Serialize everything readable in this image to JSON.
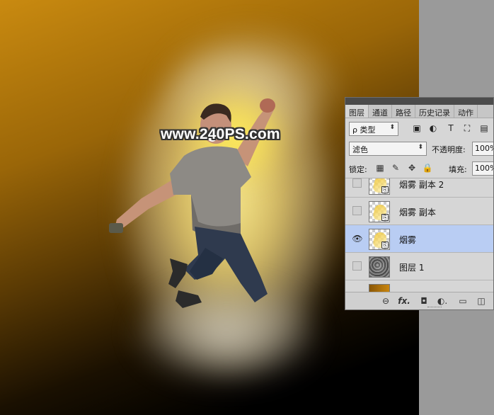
{
  "watermark": "www.240PS.com",
  "panel": {
    "tabs": [
      {
        "label": "图层",
        "active": true
      },
      {
        "label": "通道",
        "active": false
      },
      {
        "label": "路径",
        "active": false
      },
      {
        "label": "历史记录",
        "active": false
      },
      {
        "label": "动作",
        "active": false
      }
    ],
    "filter": {
      "label": "ρ 类型",
      "caret": "⬍"
    },
    "filter_icons": [
      "image-icon",
      "adjustment-icon",
      "type-icon",
      "transform-icon",
      "smart-object-icon"
    ],
    "filter_glyphs": [
      "▣",
      "◐",
      "T",
      "⛶",
      "▤"
    ],
    "blend_mode": "滤色",
    "blend_caret": "⬍",
    "opacity_label": "不透明度:",
    "opacity_value": "100%",
    "lock_label": "锁定:",
    "lock_glyphs": [
      "▦",
      "✎",
      "✥",
      "🔒"
    ],
    "fill_label": "填充:",
    "fill_value": "100%",
    "layers": [
      {
        "name": "烟雾 副本 2",
        "visible": false,
        "selected": false,
        "thumb": "smart"
      },
      {
        "name": "烟雾 副本",
        "visible": false,
        "selected": false,
        "thumb": "smart"
      },
      {
        "name": "烟雾",
        "visible": true,
        "selected": true,
        "thumb": "smart"
      },
      {
        "name": "图层 1",
        "visible": false,
        "selected": false,
        "thumb": "pixel"
      },
      {
        "name": "",
        "visible": false,
        "selected": false,
        "thumb": "fill"
      }
    ],
    "eye_glyph": "👁",
    "so_badge": "⎘",
    "bottom_glyphs": [
      "⊖",
      "fx.",
      "◘",
      "◐.",
      "▭",
      "◫"
    ]
  }
}
